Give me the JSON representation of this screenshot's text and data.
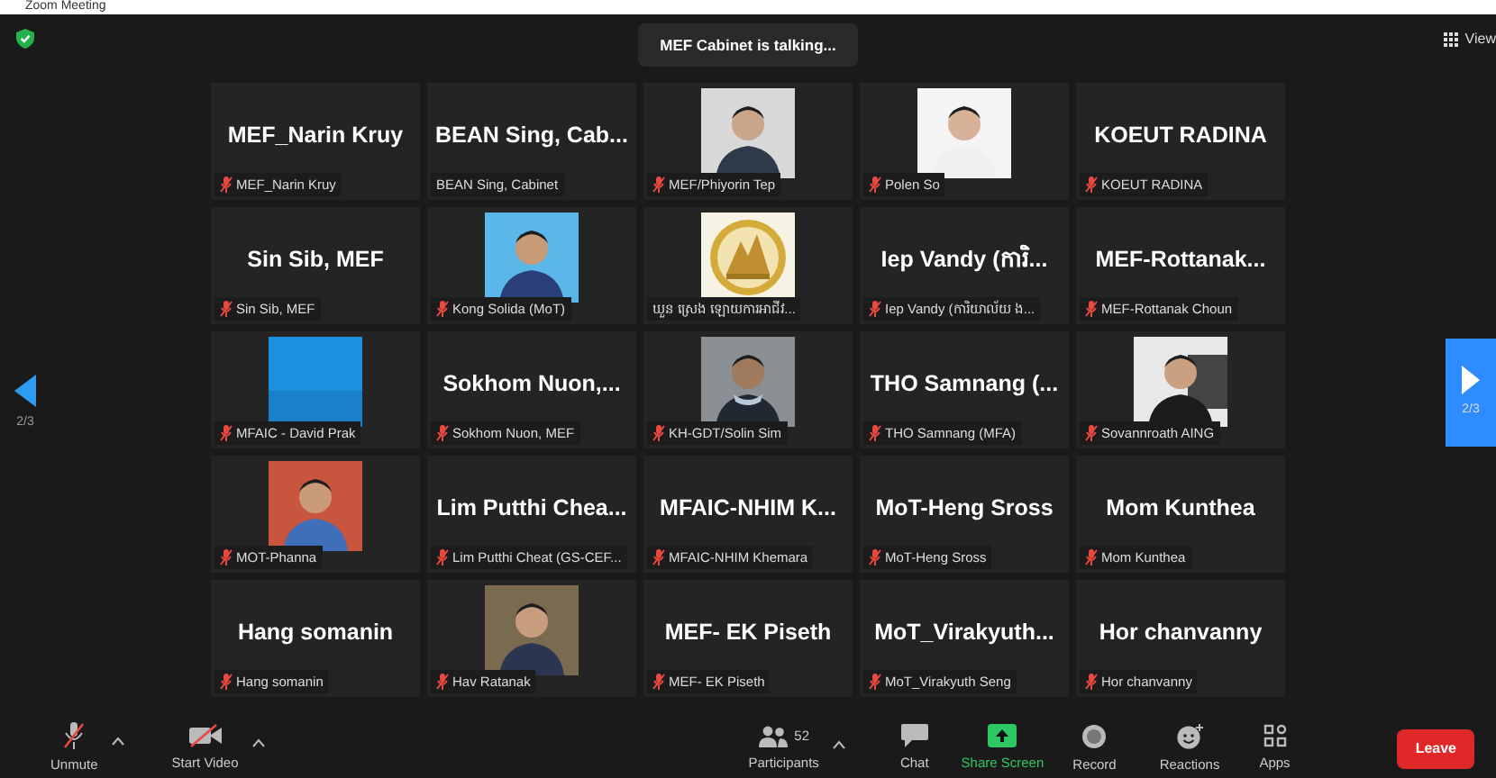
{
  "window": {
    "title": "Zoom Meeting"
  },
  "top_bar": {
    "talking": "MEF Cabinet is talking...",
    "view": "View"
  },
  "pager": {
    "left": "2/3",
    "right": "2/3"
  },
  "tiles": [
    {
      "kind": "name",
      "name": "MEF_Narin Kruy",
      "label": "MEF_Narin Kruy",
      "muted": true
    },
    {
      "kind": "name",
      "name": "BEAN Sing, Cab...",
      "label": "BEAN Sing, Cabinet",
      "muted": false
    },
    {
      "kind": "picture",
      "label": "MEF/Phiyorin Tep",
      "muted": true
    },
    {
      "kind": "picture",
      "label": "Polen So",
      "muted": true
    },
    {
      "kind": "name",
      "name": "KOEUT RADINA",
      "label": "KOEUT RADINA",
      "muted": true
    },
    {
      "kind": "name",
      "name": "Sin Sib, MEF",
      "label": "Sin Sib, MEF",
      "muted": true
    },
    {
      "kind": "picture",
      "label": "Kong Solida (MoT)",
      "muted": true
    },
    {
      "kind": "picture",
      "label": "ឃួន ស្រេង ឡោយការអាជីវ...",
      "muted": false
    },
    {
      "kind": "name",
      "name": "Iep Vandy (ការិ...",
      "label": "Iep Vandy (ការិយាល័យ ង...",
      "muted": true
    },
    {
      "kind": "name",
      "name": "MEF-Rottanak...",
      "label": "MEF-Rottanak Choun",
      "muted": true
    },
    {
      "kind": "picture",
      "label": "MFAIC - David Prak",
      "muted": true
    },
    {
      "kind": "name",
      "name": "Sokhom Nuon,...",
      "label": "Sokhom Nuon, MEF",
      "muted": true
    },
    {
      "kind": "picture",
      "label": "KH-GDT/Solin Sim",
      "muted": true
    },
    {
      "kind": "name",
      "name": "THO Samnang (...",
      "label": "THO Samnang (MFA)",
      "muted": true
    },
    {
      "kind": "picture",
      "label": "Sovannroath AING",
      "muted": true
    },
    {
      "kind": "picture",
      "label": "MOT-Phanna",
      "muted": true
    },
    {
      "kind": "name",
      "name": "Lim Putthi Chea...",
      "label": "Lim Putthi Cheat (GS-CEF...",
      "muted": true
    },
    {
      "kind": "name",
      "name": "MFAIC-NHIM K...",
      "label": "MFAIC-NHIM Khemara",
      "muted": true
    },
    {
      "kind": "name",
      "name": "MoT-Heng Sross",
      "label": "MoT-Heng Sross",
      "muted": true
    },
    {
      "kind": "name",
      "name": "Mom Kunthea",
      "label": "Mom Kunthea",
      "muted": true
    },
    {
      "kind": "name",
      "name": "Hang somanin",
      "label": "Hang somanin",
      "muted": true
    },
    {
      "kind": "picture",
      "label": "Hav Ratanak",
      "muted": true
    },
    {
      "kind": "name",
      "name": "MEF- EK Piseth",
      "label": "MEF- EK Piseth",
      "muted": true
    },
    {
      "kind": "name",
      "name": "MoT_Virakyuth...",
      "label": "MoT_Virakyuth Seng",
      "muted": true
    },
    {
      "kind": "name",
      "name": "Hor chanvanny",
      "label": "Hor chanvanny",
      "muted": true
    }
  ],
  "toolbar": [
    {
      "kind": "mic",
      "label": "Unmute",
      "caret": true
    },
    {
      "kind": "video",
      "label": "Start Video",
      "caret": true
    },
    {
      "kind": "participants",
      "label": "Participants",
      "count": "52",
      "caret": true
    },
    {
      "kind": "chat",
      "label": "Chat",
      "caret": false
    },
    {
      "kind": "share",
      "label": "Share Screen",
      "caret": false
    },
    {
      "kind": "record",
      "label": "Record",
      "caret": false
    },
    {
      "kind": "reactions",
      "label": "Reactions",
      "caret": false
    },
    {
      "kind": "apps",
      "label": "Apps",
      "caret": false
    }
  ],
  "leave_button": "Leave"
}
